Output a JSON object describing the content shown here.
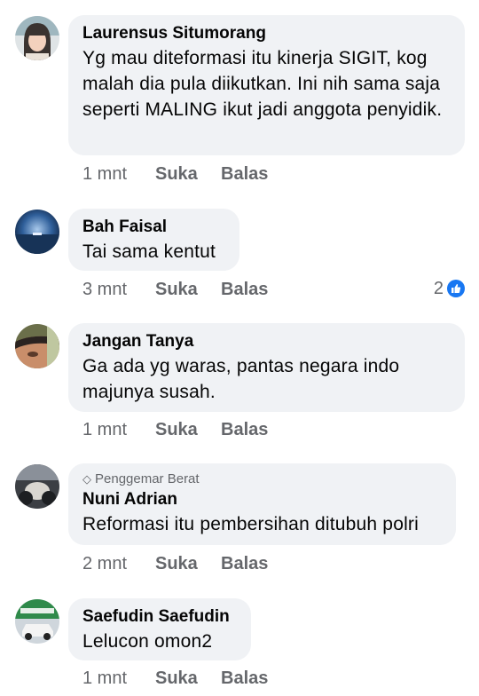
{
  "comments": [
    {
      "name": "Laurensus Situmorang",
      "badge": "",
      "text": "Yg mau diteformasi itu kinerja SIGIT, kog malah dia pula diikutkan. Ini nih sama saja seperti MALING ikut jadi anggota penyidik.",
      "time": "1 mnt",
      "like": "Suka",
      "reply": "Balas",
      "reaction_count": ""
    },
    {
      "name": "Bah Faisal",
      "badge": "",
      "text": "Tai sama kentut",
      "time": "3 mnt",
      "like": "Suka",
      "reply": "Balas",
      "reaction_count": "2"
    },
    {
      "name": "Jangan Tanya",
      "badge": "",
      "text": "Ga ada yg waras, pantas negara indo majunya susah.",
      "time": "1 mnt",
      "like": "Suka",
      "reply": "Balas",
      "reaction_count": ""
    },
    {
      "name": "Nuni Adrian",
      "badge": "Penggemar Berat",
      "text": "Reformasi itu pembersihan ditubuh polri",
      "time": "2 mnt",
      "like": "Suka",
      "reply": "Balas",
      "reaction_count": ""
    },
    {
      "name": "Saefudin Saefudin",
      "badge": "",
      "text": "Lelucon omon2",
      "time": "1 mnt",
      "like": "Suka",
      "reply": "Balas",
      "reaction_count": ""
    }
  ],
  "icons": {
    "badge": "diamond-icon",
    "reaction": "thumbs-up-icon"
  },
  "colors": {
    "bubble": "#f0f2f5",
    "meta": "#65676b",
    "like_reaction": "#1877f2"
  }
}
